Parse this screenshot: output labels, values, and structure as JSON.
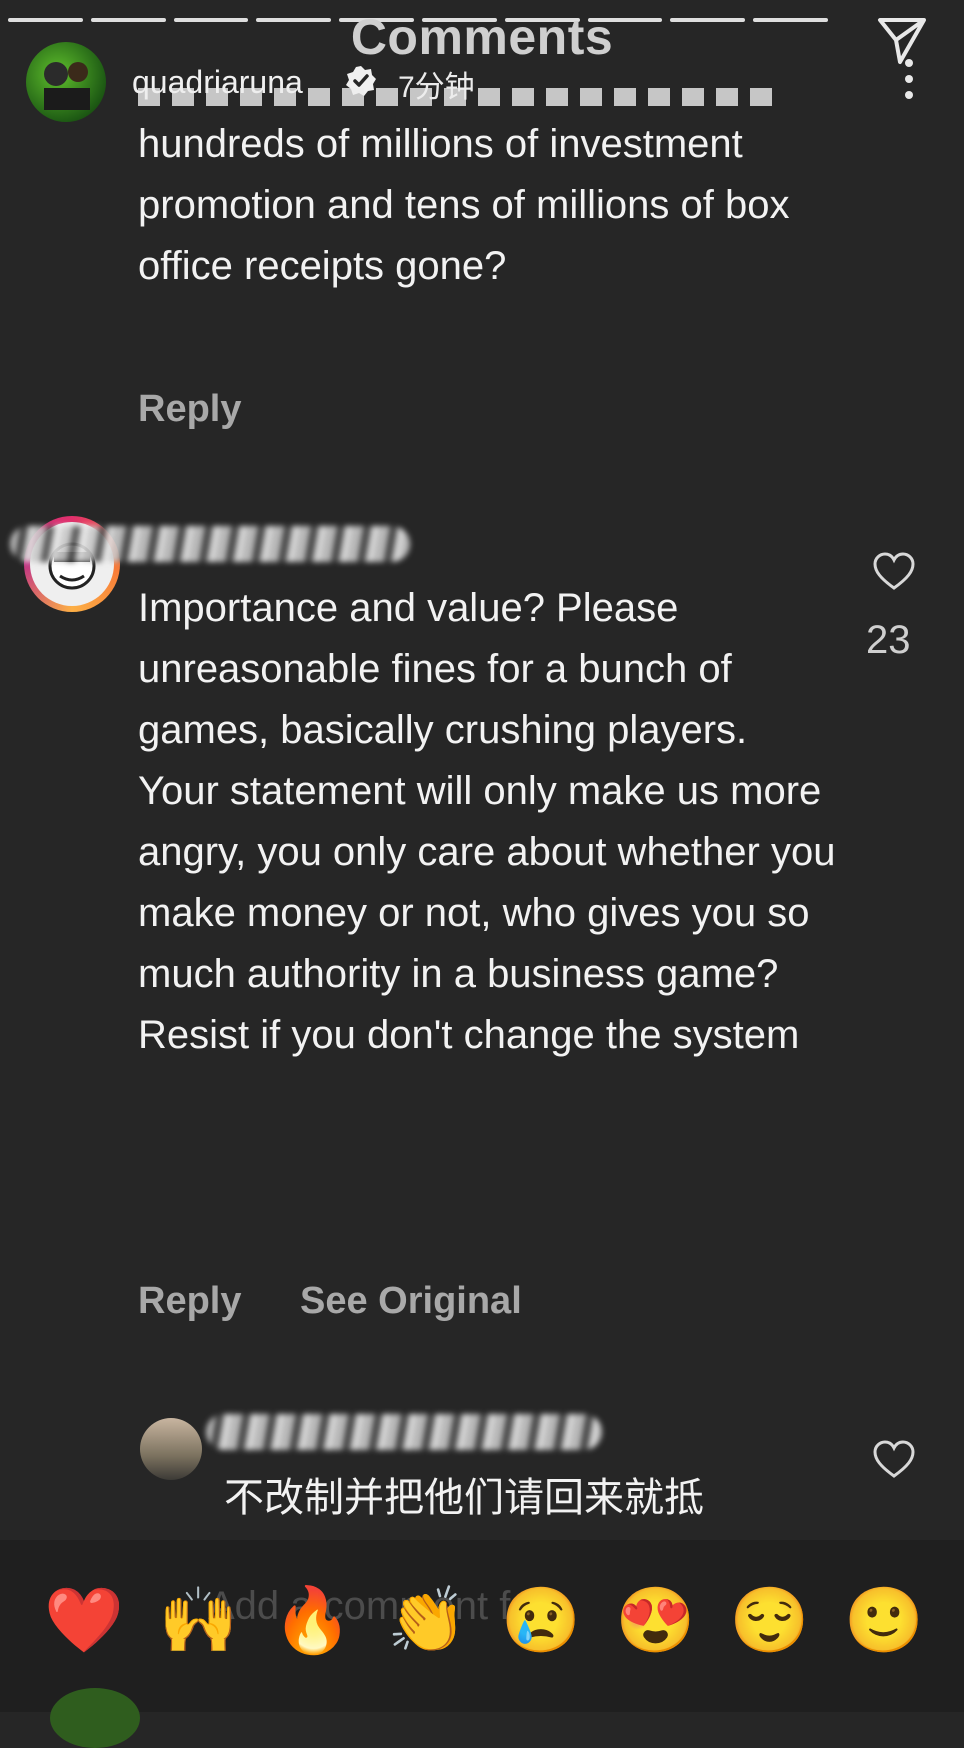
{
  "header": {
    "title": "Comments",
    "owner_name": "quadriaruna",
    "owner_time": "7分钟"
  },
  "comments": [
    {
      "text": "hundreds of millions of investment promotion and tens of millions of box office receipts gone?",
      "reply_label": "Reply"
    },
    {
      "text": "Importance and value? Please unreasonable fines for a bunch of games, basically crushing players. Your statement will only make us more angry, you only care about whether you make money or not, who gives you so much authority in a business game? Resist if you don't change the system",
      "likes": "23",
      "reply_label": "Reply",
      "see_original_label": "See Original"
    },
    {
      "text": "不改制并把他们请回来就抵"
    }
  ],
  "footer": {
    "input_placeholder": "Add a comment for",
    "emojis": [
      "❤️",
      "🙌",
      "🔥",
      "👏",
      "😢",
      "😍",
      "😌",
      "🙂"
    ]
  },
  "icons": {
    "send": "send-icon",
    "more": "more-dots-icon",
    "verified": "verified-badge-icon",
    "heart": "heart-outline-icon"
  }
}
